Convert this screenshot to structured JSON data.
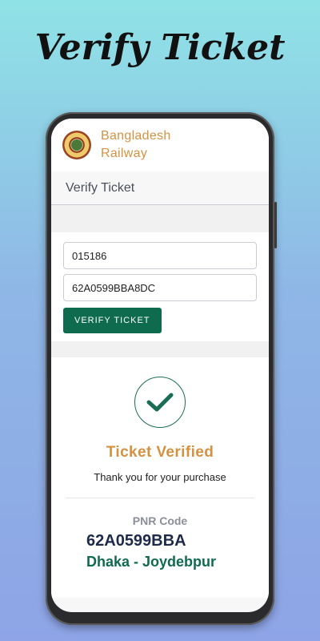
{
  "promo": {
    "title": "Verify Ticket"
  },
  "app": {
    "brand_line1": "Bangladesh",
    "brand_line2": "Railway",
    "page_title": "Verify Ticket"
  },
  "form": {
    "mobile_value": "015186",
    "pnr_value": "62A0599BBA8DC",
    "verify_label": "VERIFY TICKET"
  },
  "result": {
    "status_title": "Ticket Verified",
    "thanks_text": "Thank you for your purchase",
    "pnr_label": "PNR Code",
    "pnr_code": "62A0599BBA",
    "route": "Dhaka - Joydebpur"
  },
  "colors": {
    "accent_green": "#0f6b4d",
    "brand_orange": "#d49241",
    "pnr_navy": "#1d2a4a"
  },
  "icons": [
    "railway-logo-icon",
    "check-icon"
  ]
}
